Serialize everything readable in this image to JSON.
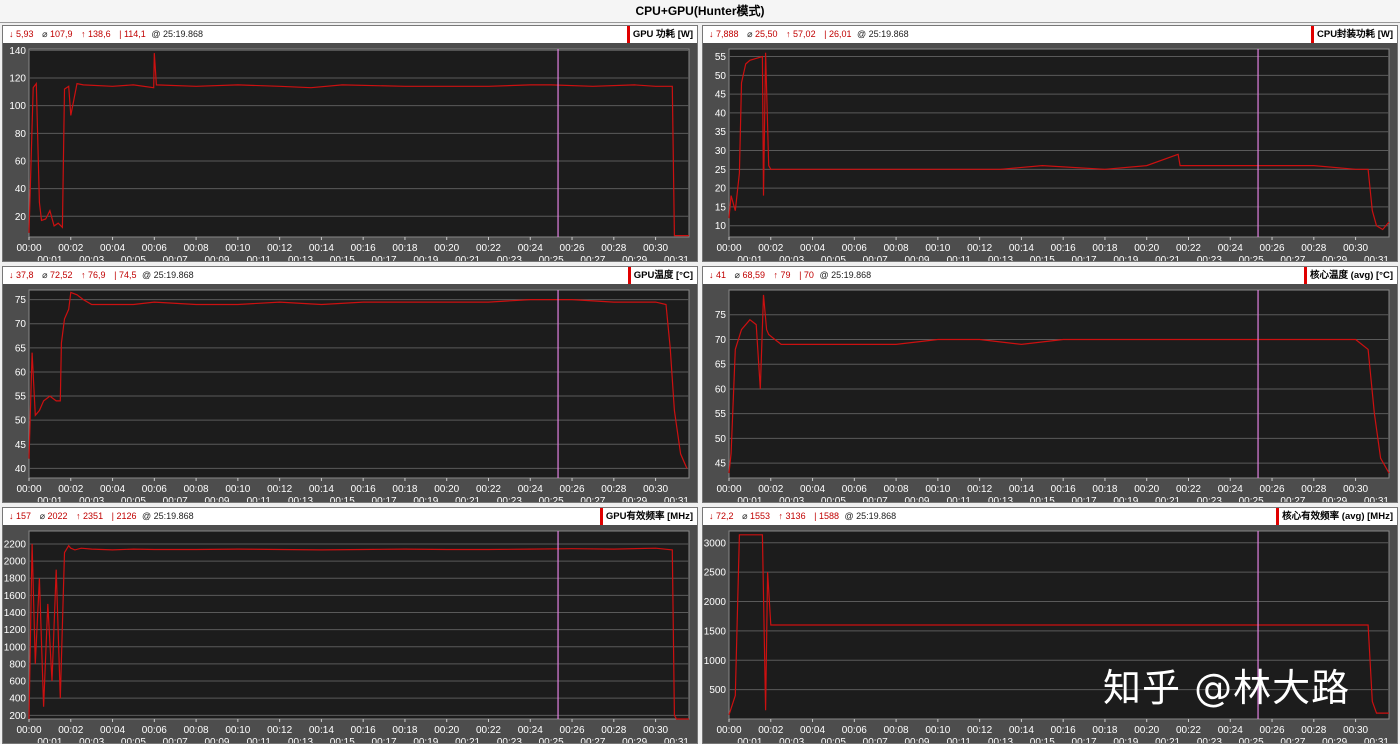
{
  "title": "CPU+GPU(Hunter模式)",
  "watermark": "知乎 @林大路",
  "colors": {
    "line": "#cc1010",
    "cursor": "#e080e0",
    "plot_bg": "#1c1c1c",
    "grid": "#5a5a5a"
  },
  "x_ticks_top": [
    "00:00",
    "00:02",
    "00:04",
    "00:06",
    "00:08",
    "00:10",
    "00:12",
    "00:14",
    "00:16",
    "00:18",
    "00:20",
    "00:22",
    "00:24",
    "00:26",
    "00:28",
    "00:30"
  ],
  "x_ticks_bottom": [
    "00:01",
    "00:03",
    "00:05",
    "00:07",
    "00:09",
    "00:11",
    "00:13",
    "00:15",
    "00:17",
    "00:19",
    "00:21",
    "00:23",
    "00:25",
    "00:27",
    "00:29",
    "00:31"
  ],
  "panels": [
    {
      "label": "GPU 功耗 [W]",
      "stats": {
        "min": "5,93",
        "avg": "107,9",
        "max": "138,6",
        "cursor": "114,1",
        "time": "25:19.868"
      }
    },
    {
      "label": "CPU封装功耗 [W]",
      "stats": {
        "min": "7,888",
        "avg": "25,50",
        "max": "57,02",
        "cursor": "26,01",
        "time": "25:19.868"
      }
    },
    {
      "label": "GPU温度 [°C]",
      "stats": {
        "min": "37,8",
        "avg": "72,52",
        "max": "76,9",
        "cursor": "74,5",
        "time": "25:19.868"
      }
    },
    {
      "label": "核心温度 (avg) [°C]",
      "stats": {
        "min": "41",
        "avg": "68,59",
        "max": "79",
        "cursor": "70",
        "time": "25:19.868"
      }
    },
    {
      "label": "GPU有效频率 [MHz]",
      "stats": {
        "min": "157",
        "avg": "2022",
        "max": "2351",
        "cursor": "2126",
        "time": "25:19.868"
      }
    },
    {
      "label": "核心有效频率 (avg) [MHz]",
      "stats": {
        "min": "72,2",
        "avg": "1553",
        "max": "3136",
        "cursor": "1588",
        "time": "25:19.868"
      }
    }
  ],
  "chart_data": [
    {
      "type": "line",
      "title": "GPU 功耗 [W]",
      "xlim": [
        0,
        31.6
      ],
      "ylim": [
        5,
        141
      ],
      "yticks": [
        20,
        40,
        60,
        80,
        100,
        120,
        140
      ],
      "cursor_x": 25.33,
      "series": [
        {
          "x": [
            0,
            0.2,
            0.35,
            0.5,
            0.6,
            0.8,
            1.0,
            1.2,
            1.4,
            1.6,
            1.7,
            1.9,
            2.0,
            2.3,
            2.6,
            4.0,
            5.0,
            5.97,
            6.0,
            6.1,
            8.0,
            10.0,
            12.0,
            13.5,
            15.0,
            18.0,
            20.0,
            22.0,
            24.0,
            25.0,
            27.0,
            29.0,
            30.0,
            30.8,
            30.9,
            31.6
          ],
          "y": [
            8,
            113,
            116,
            30,
            17,
            18,
            24,
            13,
            15,
            12,
            112,
            114,
            93,
            116,
            115,
            114,
            115,
            113,
            138,
            115,
            114,
            115,
            114,
            113,
            115,
            114,
            114,
            114,
            115,
            115,
            114,
            115,
            114,
            114,
            6,
            6
          ]
        }
      ]
    },
    {
      "type": "line",
      "title": "CPU封装功耗 [W]",
      "xlim": [
        0,
        31.6
      ],
      "ylim": [
        7,
        57
      ],
      "yticks": [
        10,
        15,
        20,
        25,
        30,
        35,
        40,
        45,
        50,
        55
      ],
      "cursor_x": 25.33,
      "series": [
        {
          "x": [
            0,
            0.1,
            0.3,
            0.5,
            0.6,
            0.8,
            1.0,
            1.6,
            1.65,
            1.75,
            1.9,
            2.0,
            3.0,
            5.0,
            8.0,
            10.0,
            13.0,
            15.0,
            18.0,
            20.0,
            21.5,
            21.6,
            22.0,
            24.0,
            26.0,
            28.0,
            30.0,
            30.6,
            30.8,
            31.0,
            31.3,
            31.6
          ],
          "y": [
            12,
            18,
            14,
            24,
            48,
            53,
            54,
            55,
            18,
            56,
            26,
            25,
            25,
            25,
            25,
            25,
            25,
            26,
            25,
            26,
            29,
            26,
            26,
            26,
            26,
            26,
            25,
            25,
            14,
            10,
            9,
            11
          ]
        }
      ]
    },
    {
      "type": "line",
      "title": "GPU温度 [°C]",
      "xlim": [
        0,
        31.6
      ],
      "ylim": [
        38,
        77
      ],
      "yticks": [
        40,
        45,
        50,
        55,
        60,
        65,
        70,
        75
      ],
      "cursor_x": 25.33,
      "series": [
        {
          "x": [
            0,
            0.15,
            0.3,
            0.5,
            0.7,
            1.0,
            1.3,
            1.5,
            1.55,
            1.7,
            1.9,
            2.0,
            2.3,
            2.6,
            3.0,
            4.0,
            5.0,
            6.0,
            8.0,
            10.0,
            12.0,
            14.0,
            16.0,
            18.0,
            20.0,
            22.0,
            24.0,
            26.0,
            28.0,
            30.0,
            30.5,
            30.7,
            30.9,
            31.2,
            31.5
          ],
          "y": [
            42,
            64,
            51,
            52,
            54,
            55,
            54,
            54,
            66,
            71,
            73,
            76.5,
            76,
            75,
            74,
            74,
            74,
            74.5,
            74,
            74,
            74.5,
            74,
            74.5,
            74.5,
            74.5,
            74.5,
            75,
            75,
            74.5,
            74.5,
            74,
            65,
            52,
            43,
            40
          ]
        }
      ]
    },
    {
      "type": "line",
      "title": "核心温度 (avg) [°C]",
      "xlim": [
        0,
        31.6
      ],
      "ylim": [
        42,
        80
      ],
      "yticks": [
        45,
        50,
        55,
        60,
        65,
        70,
        75
      ],
      "cursor_x": 25.33,
      "series": [
        {
          "x": [
            0,
            0.1,
            0.3,
            0.6,
            1.0,
            1.3,
            1.5,
            1.65,
            1.8,
            1.9,
            2.2,
            2.5,
            3.0,
            4.0,
            6.0,
            8.0,
            10.0,
            12.0,
            14.0,
            16.0,
            18.0,
            20.0,
            22.0,
            24.0,
            26.0,
            28.0,
            30.0,
            30.6,
            30.9,
            31.2,
            31.6
          ],
          "y": [
            43,
            47,
            68,
            72,
            74,
            73,
            60,
            79,
            72,
            71,
            70,
            69,
            69,
            69,
            69,
            69,
            70,
            70,
            69,
            70,
            70,
            70,
            70,
            70,
            70,
            70,
            70,
            68,
            55,
            46,
            43
          ]
        }
      ]
    },
    {
      "type": "line",
      "title": "GPU有效频率 [MHz]",
      "xlim": [
        0,
        31.6
      ],
      "ylim": [
        157,
        2351
      ],
      "yticks": [
        200,
        400,
        600,
        800,
        1000,
        1200,
        1400,
        1600,
        1800,
        2000,
        2200
      ],
      "cursor_x": 25.33,
      "series": [
        {
          "x": [
            0,
            0.15,
            0.3,
            0.5,
            0.7,
            0.9,
            1.1,
            1.3,
            1.5,
            1.7,
            1.9,
            2.0,
            2.2,
            2.5,
            3.0,
            4.0,
            5.0,
            6.0,
            8.0,
            10.0,
            12.0,
            14.0,
            16.0,
            18.0,
            20.0,
            22.0,
            24.0,
            26.0,
            28.0,
            30.0,
            30.8,
            30.9,
            31.0,
            31.6
          ],
          "y": [
            157,
            2200,
            800,
            1800,
            300,
            1500,
            600,
            1900,
            400,
            2100,
            2180,
            2150,
            2130,
            2150,
            2140,
            2130,
            2140,
            2135,
            2135,
            2140,
            2135,
            2130,
            2135,
            2140,
            2135,
            2135,
            2140,
            2145,
            2140,
            2150,
            2130,
            200,
            157,
            157
          ]
        }
      ]
    },
    {
      "type": "line",
      "title": "核心有效频率 (avg) [MHz]",
      "xlim": [
        0,
        31.6
      ],
      "ylim": [
        0,
        3200
      ],
      "yticks": [
        500,
        1000,
        1500,
        2000,
        2500,
        3000
      ],
      "cursor_x": 25.33,
      "series": [
        {
          "x": [
            0,
            0.3,
            0.5,
            0.8,
            1.2,
            1.6,
            1.75,
            1.85,
            2.0,
            3.0,
            5.0,
            8.0,
            10.0,
            12.0,
            14.0,
            16.0,
            18.0,
            20.0,
            22.0,
            24.0,
            26.0,
            28.0,
            30.0,
            30.6,
            30.8,
            31.0,
            31.6
          ],
          "y": [
            72,
            400,
            3136,
            3136,
            3136,
            3136,
            150,
            2500,
            1600,
            1600,
            1600,
            1600,
            1600,
            1600,
            1600,
            1600,
            1600,
            1600,
            1600,
            1600,
            1600,
            1600,
            1600,
            1600,
            300,
            100,
            100
          ]
        }
      ]
    }
  ]
}
